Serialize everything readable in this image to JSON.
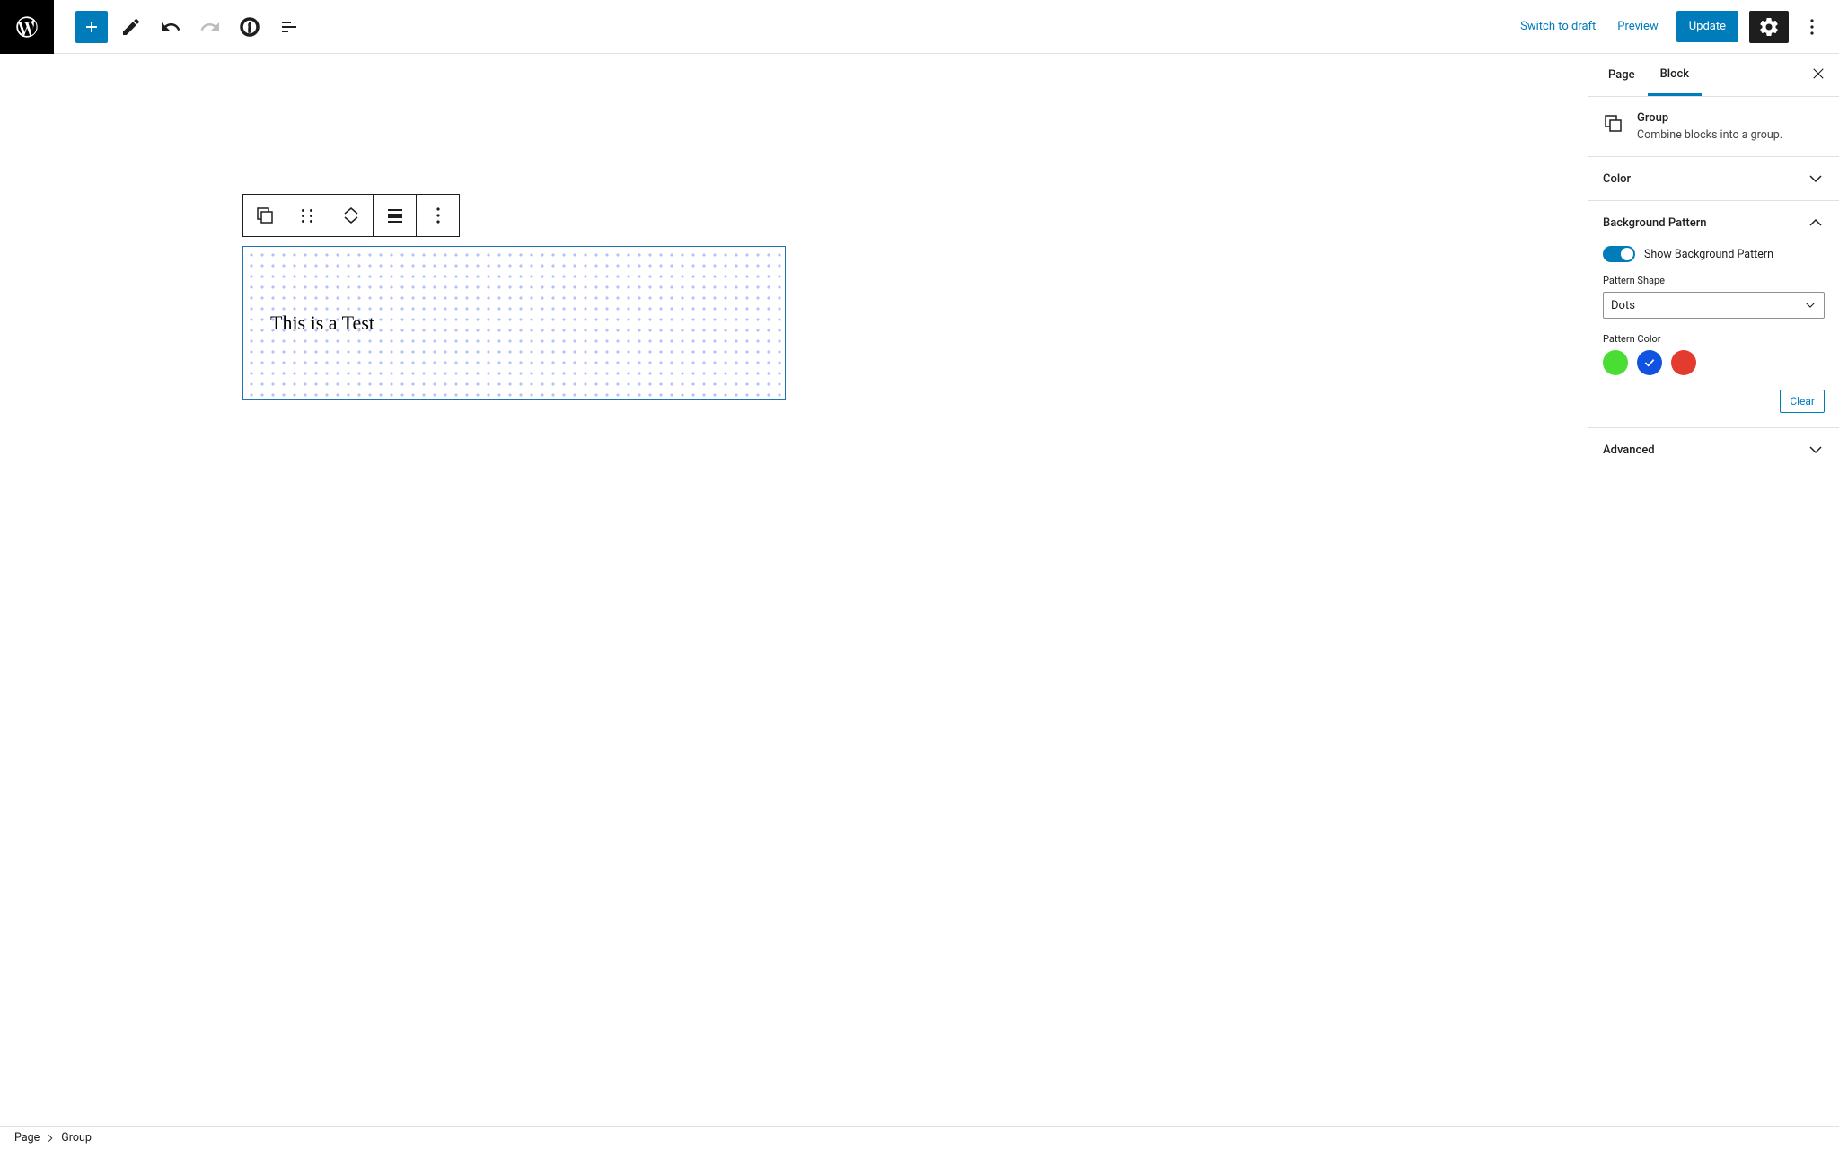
{
  "topbar": {
    "switch_draft": "Switch to draft",
    "preview": "Preview",
    "update": "Update"
  },
  "canvas": {
    "group_text": "This is a Test"
  },
  "sidebar": {
    "tabs": {
      "page": "Page",
      "block": "Block"
    },
    "block_info": {
      "title": "Group",
      "description": "Combine blocks into a group."
    },
    "panels": {
      "color": "Color",
      "background_pattern": "Background Pattern",
      "advanced": "Advanced"
    },
    "bg_pattern": {
      "toggle_label": "Show Background Pattern",
      "shape_label": "Pattern Shape",
      "shape_value": "Dots",
      "color_label": "Pattern Color",
      "clear": "Clear",
      "colors": {
        "green": "#4ade34",
        "blue": "#1152e0",
        "red": "#e33b2e"
      },
      "selected_color": "blue"
    }
  },
  "footer": {
    "crumb1": "Page",
    "crumb2": "Group"
  }
}
